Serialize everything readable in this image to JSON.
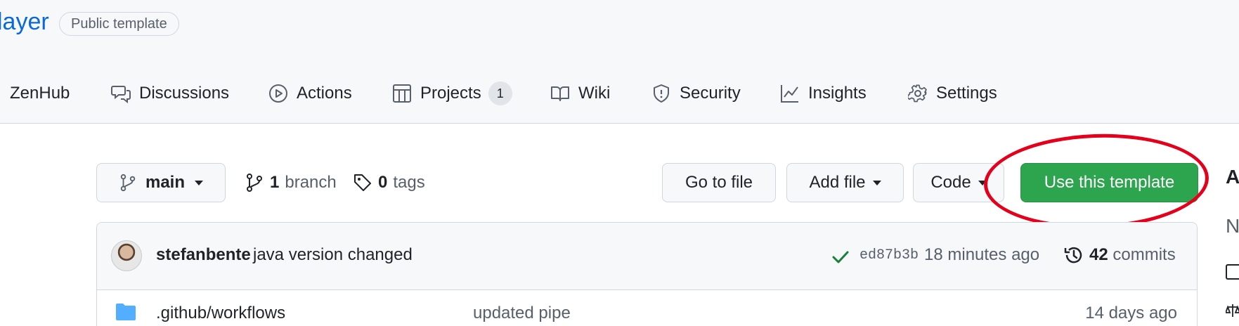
{
  "repo": {
    "name_fragment": "layer",
    "visibility_badge": "Public template"
  },
  "tabs": [
    {
      "label": "ZenHub",
      "icon": "zenhub-icon"
    },
    {
      "label": "Discussions",
      "icon": "discussion-icon"
    },
    {
      "label": "Actions",
      "icon": "play-icon"
    },
    {
      "label": "Projects",
      "icon": "table-icon",
      "count": "1"
    },
    {
      "label": "Wiki",
      "icon": "book-icon"
    },
    {
      "label": "Security",
      "icon": "shield-icon"
    },
    {
      "label": "Insights",
      "icon": "graph-icon"
    },
    {
      "label": "Settings",
      "icon": "gear-icon"
    }
  ],
  "toolbar": {
    "branch_selector": "main",
    "branch_count": "1",
    "branch_label": "branch",
    "tag_count": "0",
    "tag_label": "tags",
    "go_to_file": "Go to file",
    "add_file": "Add file",
    "code": "Code",
    "use_template": "Use this template"
  },
  "right_edge": {
    "top_char": "A",
    "mid_char": "N"
  },
  "latest_commit": {
    "author": "stefanbente",
    "message": "java version changed",
    "status": "success",
    "sha": "ed87b3b",
    "time": "18 minutes ago",
    "commit_count": "42",
    "commit_label": "commits"
  },
  "files": [
    {
      "name": ".github/workflows",
      "type": "folder",
      "commit_message": "updated pipe",
      "time": "14 days ago"
    }
  ],
  "colors": {
    "primary_button": "#2da44e",
    "link": "#0969da",
    "annotation": "#e4001b"
  }
}
